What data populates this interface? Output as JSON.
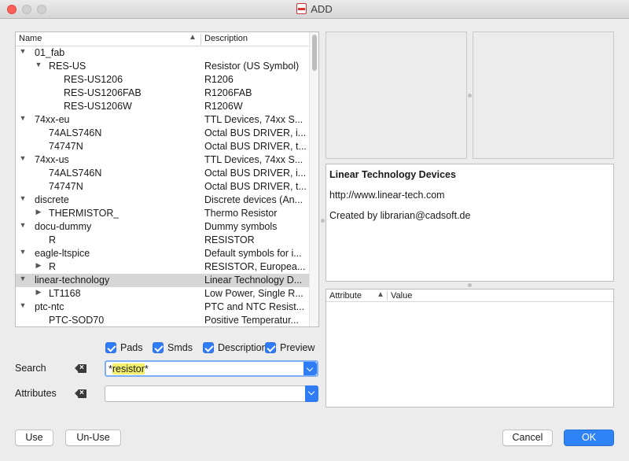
{
  "window": {
    "title": "ADD"
  },
  "tree": {
    "headers": {
      "name": "Name",
      "description": "Description"
    },
    "rows": [
      {
        "name": "01_fab",
        "description": "",
        "indent": 0,
        "arrow": "open"
      },
      {
        "name": "RES-US",
        "description": "Resistor (US Symbol)",
        "indent": 1,
        "arrow": "open"
      },
      {
        "name": "RES-US1206",
        "description": "R1206",
        "indent": 2,
        "arrow": ""
      },
      {
        "name": "RES-US1206FAB",
        "description": "R1206FAB",
        "indent": 2,
        "arrow": ""
      },
      {
        "name": "RES-US1206W",
        "description": "R1206W",
        "indent": 2,
        "arrow": ""
      },
      {
        "name": "74xx-eu",
        "description": "TTL Devices, 74xx S...",
        "indent": 0,
        "arrow": "open"
      },
      {
        "name": "74ALS746N",
        "description": "Octal BUS DRIVER, i...",
        "indent": 1,
        "arrow": ""
      },
      {
        "name": "74747N",
        "description": "Octal BUS DRIVER, t...",
        "indent": 1,
        "arrow": ""
      },
      {
        "name": "74xx-us",
        "description": "TTL Devices, 74xx S...",
        "indent": 0,
        "arrow": "open"
      },
      {
        "name": "74ALS746N",
        "description": "Octal BUS DRIVER, i...",
        "indent": 1,
        "arrow": ""
      },
      {
        "name": "74747N",
        "description": "Octal BUS DRIVER, t...",
        "indent": 1,
        "arrow": ""
      },
      {
        "name": "discrete",
        "description": "Discrete devices (An...",
        "indent": 0,
        "arrow": "open"
      },
      {
        "name": "THERMISTOR_",
        "description": "Thermo Resistor",
        "indent": 1,
        "arrow": "closed"
      },
      {
        "name": "docu-dummy",
        "description": "Dummy symbols",
        "indent": 0,
        "arrow": "open"
      },
      {
        "name": "R",
        "description": "RESISTOR",
        "indent": 1,
        "arrow": ""
      },
      {
        "name": "eagle-ltspice",
        "description": "Default symbols for i...",
        "indent": 0,
        "arrow": "open"
      },
      {
        "name": "R",
        "description": "RESISTOR, Europea...",
        "indent": 1,
        "arrow": "closed"
      },
      {
        "name": "linear-technology",
        "description": "Linear Technology D...",
        "indent": 0,
        "arrow": "open",
        "selected": true
      },
      {
        "name": "LT1168",
        "description": "Low Power, Single R...",
        "indent": 1,
        "arrow": "closed"
      },
      {
        "name": "ptc-ntc",
        "description": "PTC and NTC Resist...",
        "indent": 0,
        "arrow": "open"
      },
      {
        "name": "PTC-SOD70",
        "description": "Positive Temperatur...",
        "indent": 1,
        "arrow": ""
      }
    ]
  },
  "options": {
    "pads": "Pads",
    "smds": "Smds",
    "description": "Description",
    "preview": "Preview"
  },
  "search": {
    "label": "Search",
    "prefix": "*",
    "highlight": "resistor",
    "suffix": "*"
  },
  "attributes": {
    "label": "Attributes",
    "value": ""
  },
  "info": {
    "title": "Linear Technology Devices",
    "url": "http://www.linear-tech.com",
    "created_by": "Created by librarian@cadsoft.de"
  },
  "attribute_table": {
    "col_attribute": "Attribute",
    "col_value": "Value"
  },
  "buttons": {
    "use": "Use",
    "unuse": "Un-Use",
    "cancel": "Cancel",
    "ok": "OK"
  },
  "colors": {
    "accent": "#2f7cf6",
    "search_highlight": "#f3f06b",
    "selected_row": "#d6d6d6"
  }
}
